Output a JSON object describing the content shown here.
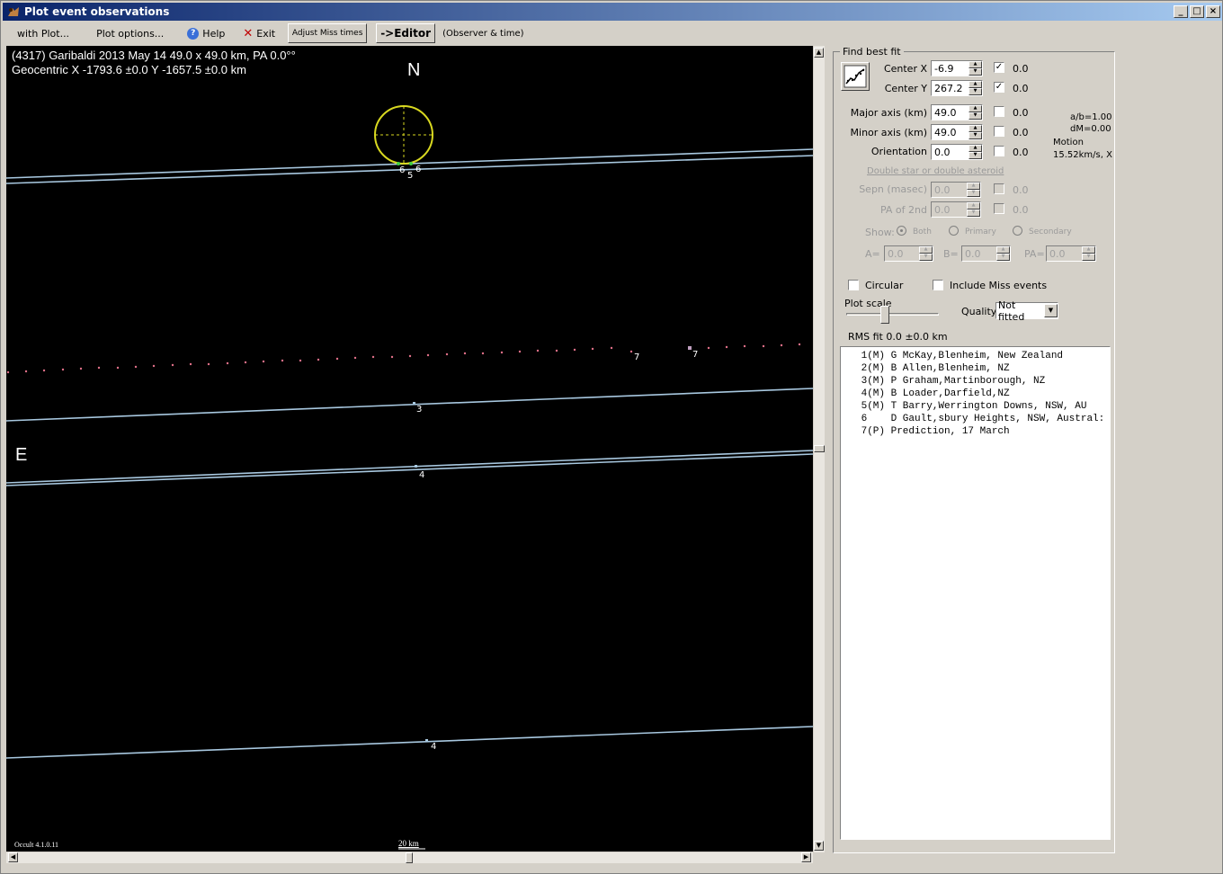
{
  "window": {
    "title": "Plot event observations",
    "buttons": {
      "minimize": "_",
      "maximize": "□",
      "close": "×"
    }
  },
  "menu": {
    "with_plot": "with Plot...",
    "plot_options": "Plot options...",
    "help": "Help",
    "exit": "Exit",
    "adjust_miss_times": "Adjust Miss times",
    "editor": "->Editor",
    "observer_time": "(Observer & time)"
  },
  "plot": {
    "title_line1": "(4317) Garibaldi  2013 May 14   49.0 x 49.0 km, PA 0.0°°",
    "title_line2": "Geocentric X -1793.6 ±0.0  Y -1657.5 ±0.0 km",
    "north": "N",
    "east": "E",
    "version": "Occult 4.1.0.11",
    "scale": "20 km",
    "chord_labels": [
      "5",
      "6",
      "6",
      "7",
      "7",
      "3",
      "4",
      "4"
    ],
    "colors": {
      "background": "#000000",
      "chord": "#a8c8e0",
      "ellipse": "#d8d820",
      "prediction": "#e07088"
    }
  },
  "panel": {
    "find_best_fit": "Find best fit",
    "center_x": {
      "label": "Center X",
      "value": "-6.9",
      "checked": true,
      "uncert": "0.0"
    },
    "center_y": {
      "label": "Center Y",
      "value": "267.2",
      "checked": true,
      "uncert": "0.0"
    },
    "major_axis": {
      "label": "Major axis (km)",
      "value": "49.0",
      "checked": false,
      "uncert": "0.0"
    },
    "minor_axis": {
      "label": "Minor axis (km)",
      "value": "49.0",
      "checked": false,
      "uncert": "0.0"
    },
    "orientation": {
      "label": "Orientation",
      "value": "0.0",
      "checked": false,
      "uncert": "0.0"
    },
    "ab_ratio": "a/b=1.00",
    "dm": "dM=0.00",
    "motion_label": "Motion",
    "motion_value": "15.52km/s, X",
    "double_star": "Double star  or  double asteroid",
    "sepn": {
      "label": "Sepn (masec)",
      "value": "0.0",
      "uncert": "0.0"
    },
    "pa2": {
      "label": "PA of 2nd",
      "value": "0.0",
      "uncert": "0.0"
    },
    "show_label": "Show:",
    "show_both": "Both",
    "show_primary": "Primary",
    "show_secondary": "Secondary",
    "a_label": "A=",
    "a_value": "0.0",
    "b_label": "B=",
    "b_value": "0.0",
    "pa_label": "PA=",
    "pa_value": "0.0",
    "circular": "Circular",
    "include_miss": "Include Miss events",
    "plot_scale": "Plot scale",
    "quality_label": "Quality",
    "quality_value": "Not fitted",
    "rms_fit": "RMS fit 0.0 ±0.0 km",
    "observers": [
      " 1(M) G McKay,Blenheim, New Zealand",
      " 2(M) B Allen,Blenheim, NZ",
      " 3(M) P Graham,Martinborough, NZ",
      " 4(M) B Loader,Darfield,NZ",
      " 5(M) T Barry,Werrington Downs, NSW, AU",
      " 6    D Gault,sbury Heights, NSW, Austral:",
      " 7(P) Prediction, 17 March"
    ]
  }
}
